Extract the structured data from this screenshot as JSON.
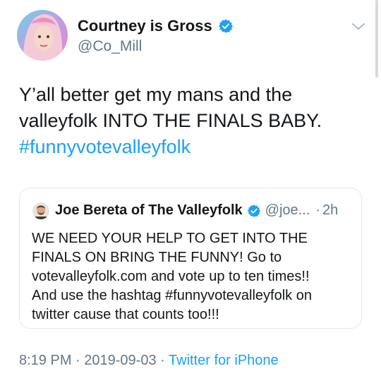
{
  "colors": {
    "link": "#1da1f2",
    "secondary_text": "#657786",
    "primary_text": "#14171a",
    "verified_badge": "#1da1f2"
  },
  "icons": {
    "verified": "verified-badge-icon",
    "caret": "chevron-down-icon"
  },
  "author": {
    "display_name": "Courtney is Gross",
    "handle": "@Co_Mill"
  },
  "tweet": {
    "text_lines": [
      "Y’all better get my mans and the",
      "valleyfolk INTO THE FINALS BABY."
    ],
    "hashtag": "#funnyvotevalleyfolk"
  },
  "quote": {
    "display_name": "Joe Bereta of The Valleyfolk",
    "handle": "@joe...",
    "separator": "·",
    "time": "2h",
    "text_lines": [
      "WE NEED YOUR HELP TO GET INTO THE",
      "FINALS ON BRING THE FUNNY! Go to",
      "votevalleyfolk.com and vote up to ten times!!",
      "And use the hashtag #funnyvotevalleyfolk on",
      "twitter cause that counts too!!!"
    ]
  },
  "meta": {
    "time": "8:19 PM",
    "separator": "·",
    "date": "2019-09-03",
    "source": "Twitter for iPhone"
  }
}
